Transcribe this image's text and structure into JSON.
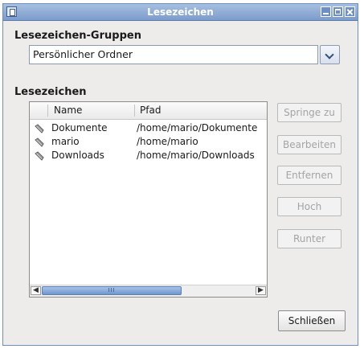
{
  "window": {
    "title": "Lesezeichen"
  },
  "groups": {
    "label": "Lesezeichen-Gruppen",
    "selected": "Persönlicher Ordner"
  },
  "bookmarks": {
    "label": "Lesezeichen",
    "columns": {
      "name": "Name",
      "path": "Pfad"
    },
    "rows": [
      {
        "name": "Dokumente",
        "path": "/home/mario/Dokumente",
        "icon": "bookmark-icon"
      },
      {
        "name": "mario",
        "path": "/home/mario",
        "icon": "bookmark-icon"
      },
      {
        "name": "Downloads",
        "path": "/home/mario/Downloads",
        "icon": "bookmark-icon"
      }
    ],
    "scrollbar": {
      "grip": "III"
    }
  },
  "actions": {
    "goto": "Springe zu",
    "edit": "Bearbeiten",
    "remove": "Entfernen",
    "up": "Hoch",
    "down": "Runter"
  },
  "close_button": "Schließen",
  "colors": {
    "titlebar": "#7c9ccb",
    "accent": "#6f96cf",
    "disabled_text": "#a4a4a4"
  }
}
